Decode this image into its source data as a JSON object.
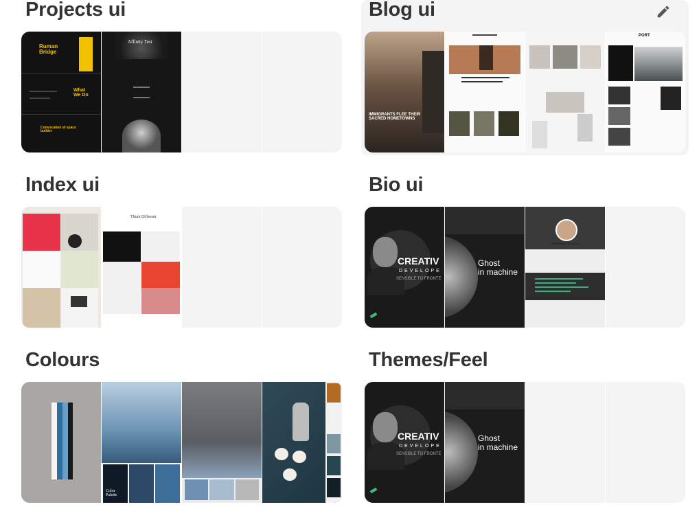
{
  "boards": [
    {
      "title": "Projects ui",
      "previews": [
        "ruman-bridge",
        "affinity-test",
        "empty",
        "empty"
      ],
      "text": {
        "p1_title": "Ruman\nBridge",
        "p1_mid": "What\nWe Do",
        "p1_bottom": "Convocation of space\nbuilder",
        "p2_title": "Affinity Test"
      }
    },
    {
      "title": "Blog ui",
      "hovered": true,
      "edit_icon": "pencil-icon",
      "previews": [
        "immigrants",
        "blog-magazine",
        "blog-white",
        "blog-port"
      ],
      "text": {
        "p1_headline": "IMMIGRANTS FLEE THEIR\nSACRED HOMETOWNS",
        "p4_logo": "PORT"
      }
    },
    {
      "title": "Index ui",
      "previews": [
        "deer-grid",
        "think-different",
        "empty",
        "empty"
      ],
      "text": {
        "p2_title": "Think Different"
      }
    },
    {
      "title": "Bio ui",
      "previews": [
        "creative-developer",
        "ghost-machine",
        "resume",
        "empty"
      ],
      "text": {
        "p1_big": "CREATIV",
        "p1_sub": "DEVELOPE",
        "p1_small": "SENSIBLE TO FRONTE",
        "p2_big": "Ghost\nin machine",
        "p3_name": "PERSONAL DETAILS"
      }
    },
    {
      "title": "Colours",
      "previews": [
        "stripes",
        "mountains",
        "wood-palette",
        "coffee"
      ],
      "text": {
        "p2_label": "Color\nPalette"
      }
    },
    {
      "title": "Themes/Feel",
      "previews": [
        "creative-developer",
        "ghost-machine",
        "empty",
        "empty"
      ],
      "text": {
        "p1_big": "CREATIV",
        "p1_sub": "DEVELOPE",
        "p1_small": "SENSIBLE TO FRONTE",
        "p2_big": "Ghost\nin machine"
      }
    }
  ],
  "colors": {
    "title": "#333333",
    "hover_bg": "#f4f4f4",
    "empty_tile": "#f4f4f4"
  }
}
